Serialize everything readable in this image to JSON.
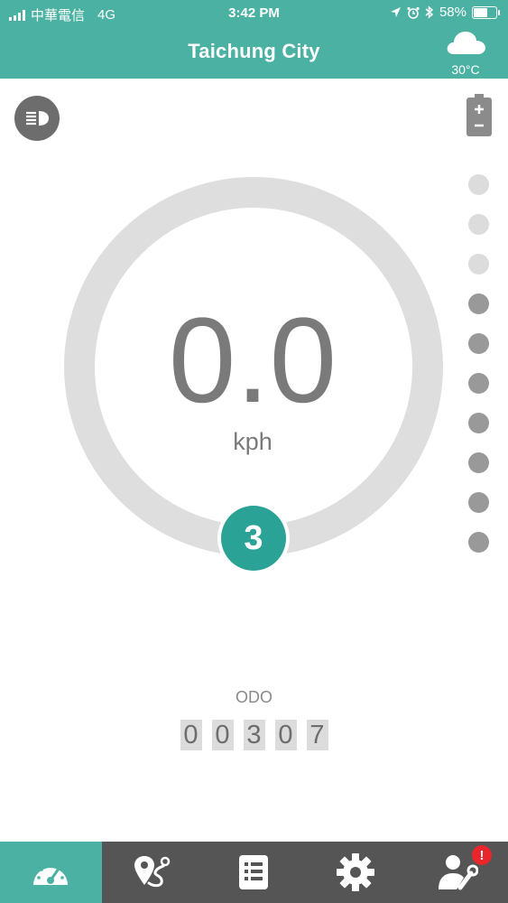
{
  "status_bar": {
    "carrier": "中華電信",
    "network": "4G",
    "time": "3:42 PM",
    "battery_percent": "58%"
  },
  "header": {
    "title": "Taichung City",
    "weather_icon": "cloud-icon",
    "temperature": "30°C"
  },
  "dashboard": {
    "speed": "0.0",
    "unit": "kph",
    "gear": "3",
    "assist_levels": [
      "light",
      "light",
      "light",
      "dark",
      "dark",
      "dark",
      "dark",
      "dark",
      "dark",
      "dark"
    ],
    "odo_label": "ODO",
    "odo_digits": [
      "0",
      "0",
      "3",
      "0",
      "7"
    ]
  },
  "colors": {
    "accent": "#4bb1a3",
    "gear": "#2aa396",
    "ring": "#dddedd",
    "tabbar": "#555555",
    "badge": "#e8262b"
  },
  "tabs": [
    {
      "name": "dashboard",
      "icon": "speedometer-icon",
      "active": true
    },
    {
      "name": "route",
      "icon": "map-pin-route-icon",
      "active": false
    },
    {
      "name": "records",
      "icon": "list-document-icon",
      "active": false
    },
    {
      "name": "settings",
      "icon": "gear-icon",
      "active": false
    },
    {
      "name": "service",
      "icon": "user-wrench-icon",
      "active": false,
      "badge": "!"
    }
  ]
}
